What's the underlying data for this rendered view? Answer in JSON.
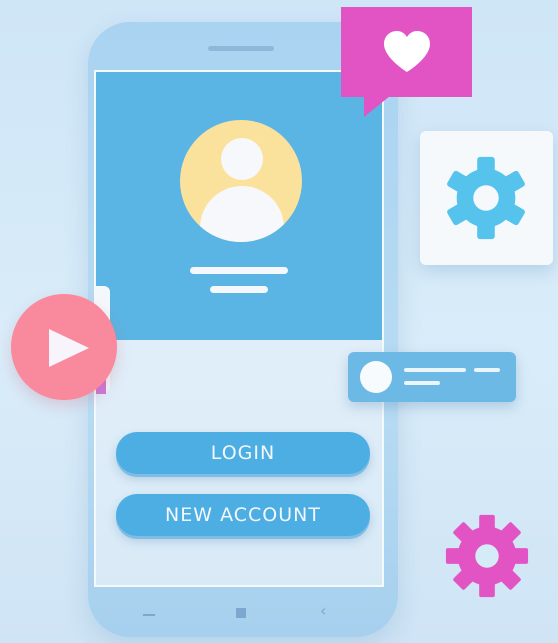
{
  "buttons": {
    "login_label": "LOGIN",
    "new_account_label": "NEW ACCOUNT"
  },
  "icons": {
    "heart": "heart-icon",
    "gear": "gear-icon",
    "play": "play-icon",
    "user": "user-avatar-icon",
    "toggle": "toggle-icon"
  },
  "colors": {
    "background": "#d5e9f8",
    "phone": "#aed5f1",
    "screen_header": "#5bb5e4",
    "avatar": "#fbe29c",
    "button": "#4daee3",
    "heart_card": "#e254c3",
    "gear_blue": "#56c3ec",
    "gear_pink": "#e254c3",
    "play": "#f9899d"
  }
}
